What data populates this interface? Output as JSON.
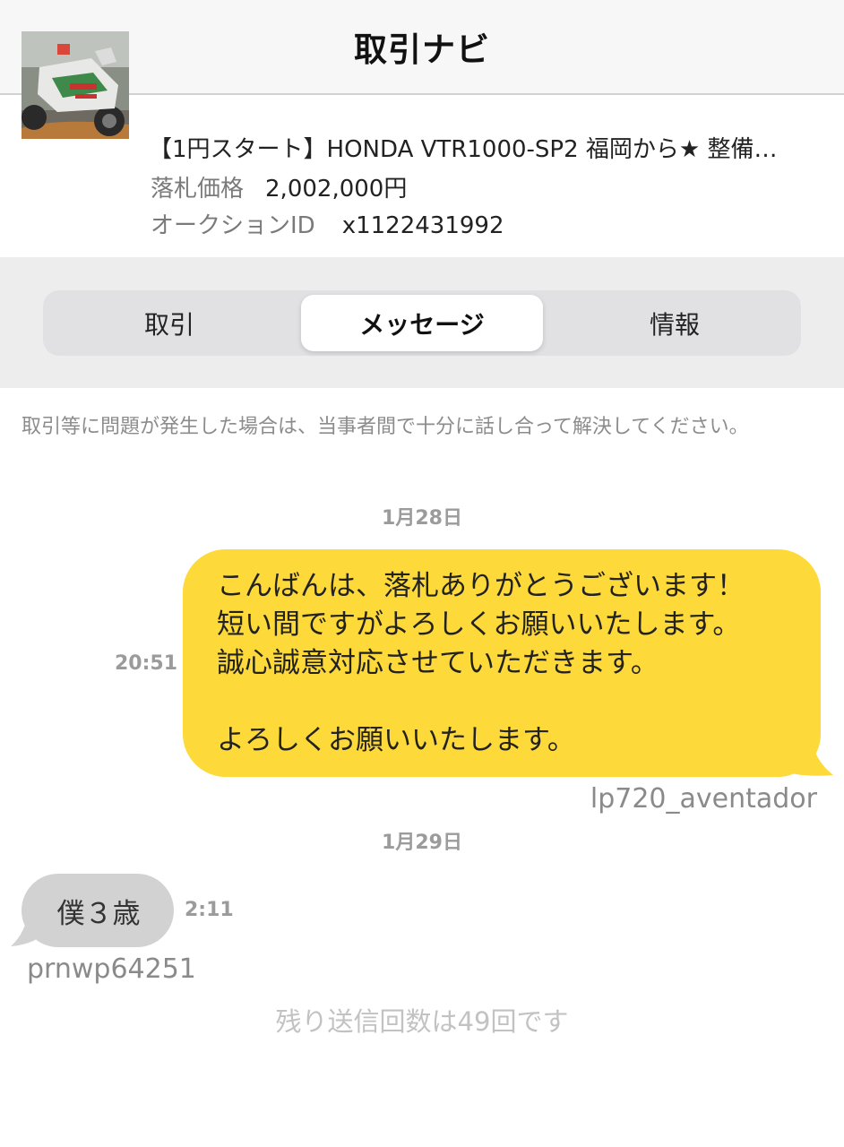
{
  "header": {
    "title": "取引ナビ"
  },
  "item": {
    "image_icon": "motorcycle-photo",
    "title": "【1円スタート】HONDA VTR1000-SP2 福岡から★ 整備…",
    "price_label": "落札価格",
    "price_value": "2,002,000円",
    "auction_id_label": "オークションID",
    "auction_id_value": "x1122431992"
  },
  "tabs": [
    {
      "label": "取引",
      "selected": false
    },
    {
      "label": "メッセージ",
      "selected": true
    },
    {
      "label": "情報",
      "selected": false
    }
  ],
  "notice": "取引等に問題が発生した場合は、当事者間で十分に話し合って解決してください。",
  "messages": [
    {
      "date": "1月28日",
      "time": "20:51",
      "text": "こんばんは、落札ありがとうございます！\n短い間ですがよろしくお願いいたします。\n誠心誠意対応させていただきます。\n\nよろしくお願いいたします。",
      "sender": "lp720_aventador",
      "direction": "outgoing"
    },
    {
      "date": "1月29日",
      "time": "2:11",
      "text": "僕３歳",
      "sender": "prnwp64251",
      "direction": "incoming"
    }
  ],
  "remaining": "残り送信回数は49回です",
  "colors": {
    "outgoing_bubble": "#fdd939",
    "incoming_bubble": "#d2d2d2",
    "tab_bar": "#e1e1e3",
    "header_bg": "#f7f7f7"
  }
}
